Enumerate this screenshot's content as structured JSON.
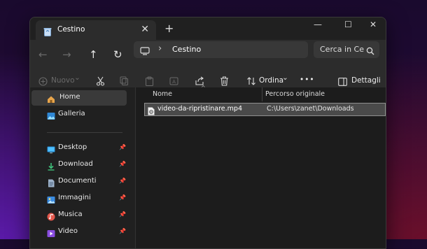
{
  "tab": {
    "title": "Cestino",
    "close": "✕"
  },
  "newtab": "+",
  "window_controls": {
    "minimize": "—",
    "maximize": "☐",
    "close": "✕"
  },
  "nav": {
    "back": "←",
    "forward": "→",
    "up": "↑",
    "refresh": "↻"
  },
  "address": {
    "separator": "›",
    "path": "Cestino"
  },
  "search": {
    "placeholder": "Cerca in Ce"
  },
  "toolbar": {
    "new_label": "Nuovo",
    "new_chevron": "⌄",
    "sort_label": "Ordina",
    "sort_chevron": "⌄",
    "more": "•••",
    "details_label": "Dettagli"
  },
  "sidebar": {
    "items": [
      {
        "label": "Home",
        "icon": "home-icon",
        "pinned": false,
        "selected": true
      },
      {
        "label": "Galleria",
        "icon": "gallery-icon",
        "pinned": false,
        "selected": false
      },
      {
        "label": "Desktop",
        "icon": "desktop-icon",
        "pinned": true
      },
      {
        "label": "Download",
        "icon": "download-icon",
        "pinned": true
      },
      {
        "label": "Documenti",
        "icon": "documents-icon",
        "pinned": true
      },
      {
        "label": "Immagini",
        "icon": "pictures-icon",
        "pinned": true
      },
      {
        "label": "Musica",
        "icon": "music-icon",
        "pinned": true
      },
      {
        "label": "Video",
        "icon": "video-icon",
        "pinned": true
      }
    ],
    "pin_glyph": "📌"
  },
  "columns": {
    "name": "Nome",
    "original_path": "Percorso originale",
    "sort_indicator": "^"
  },
  "files": [
    {
      "name": "video-da-ripristinare.mp4",
      "original_path": "C:\\Users\\zanet\\Downloads"
    }
  ],
  "colors": {
    "accent": "#4aa8ff",
    "window_bg": "#202020",
    "selected_row": "#4a4a4a"
  }
}
